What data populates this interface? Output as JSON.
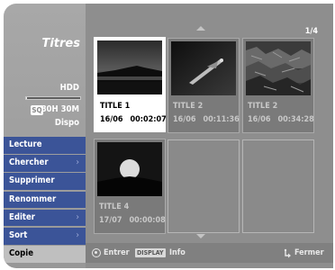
{
  "sidebar": {
    "title": "Titres",
    "disk": "HDD",
    "disk_fill": 0.02,
    "quality_badge": "SQ",
    "capacity": "80H 30M",
    "free_label": "Dispo",
    "menu": [
      {
        "label": "Lecture",
        "has_submenu": false
      },
      {
        "label": "Chercher",
        "has_submenu": true
      },
      {
        "label": "Supprimer",
        "has_submenu": false
      },
      {
        "label": "Renommer",
        "has_submenu": false
      },
      {
        "label": "Editer",
        "has_submenu": true
      },
      {
        "label": "Sort",
        "has_submenu": true
      },
      {
        "label": "Copie",
        "has_submenu": false
      }
    ],
    "submenu_arrow": "›"
  },
  "grid": {
    "page": "1/4",
    "tiles": [
      {
        "title": "TITLE 1",
        "date": "16/06",
        "duration": "00:02:07",
        "selected": true,
        "thumb": "lake-sunset"
      },
      {
        "title": "TITLE 2",
        "date": "16/06",
        "duration": "00:11:36",
        "selected": false,
        "thumb": "plane-sky"
      },
      {
        "title": "TITLE 2",
        "date": "16/06",
        "duration": "00:34:28",
        "selected": false,
        "thumb": "rocky-field"
      },
      {
        "title": "TITLE 4",
        "date": "17/07",
        "duration": "00:00:08",
        "selected": false,
        "thumb": "moon-hill"
      }
    ],
    "empty_slots": 2
  },
  "hints": {
    "enter": "Entrer",
    "display_key": "DISPLAY",
    "info": "Info",
    "close": "Fermer"
  },
  "colors": {
    "menu_blue": "#3b5498",
    "panel_gray": "#8e8e8e",
    "selected_tile": "#ffffff"
  }
}
